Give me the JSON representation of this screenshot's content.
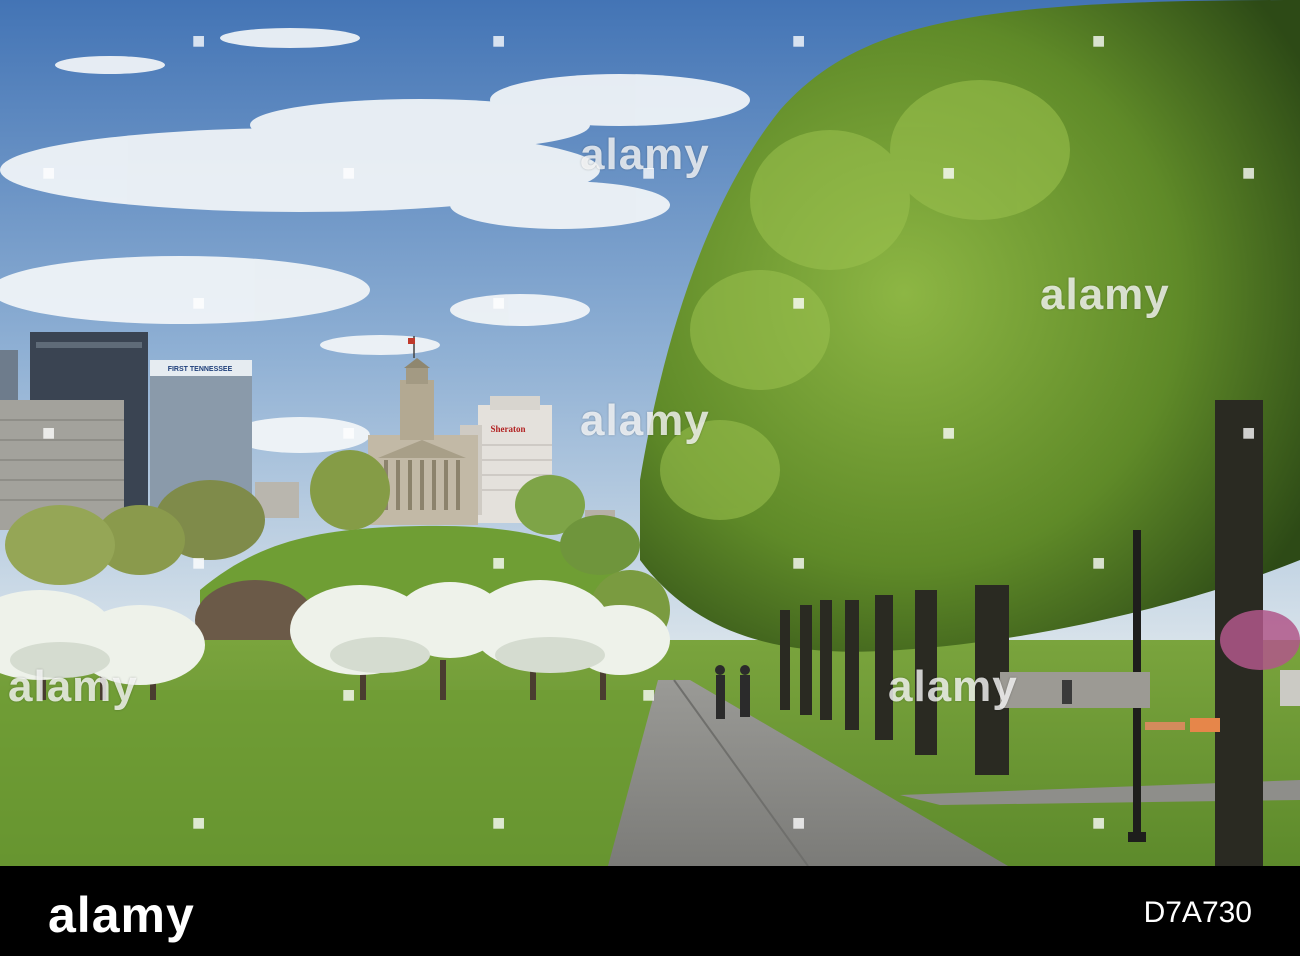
{
  "photo": {
    "alt": "City skyline and capitol on a hill seen across a park with a paved path, blossoming trees and a row of green trees",
    "buildings": {
      "first_tennessee_sign": "FIRST TENNESSEE",
      "hotel_sign": "Sheraton"
    },
    "colors": {
      "sky_top": "#3f73b8",
      "sky_bottom": "#c9d8e6",
      "lawn": "#6f9a3a",
      "foliage": "#6e9a2e",
      "blossom": "#eef2ea",
      "path": "#8a8a88"
    }
  },
  "watermark": {
    "text": "alamy",
    "dot_icon": "watermark-dot-icon"
  },
  "footer": {
    "logo": "alamy",
    "image_id": "D7A730",
    "background": "#000000"
  }
}
